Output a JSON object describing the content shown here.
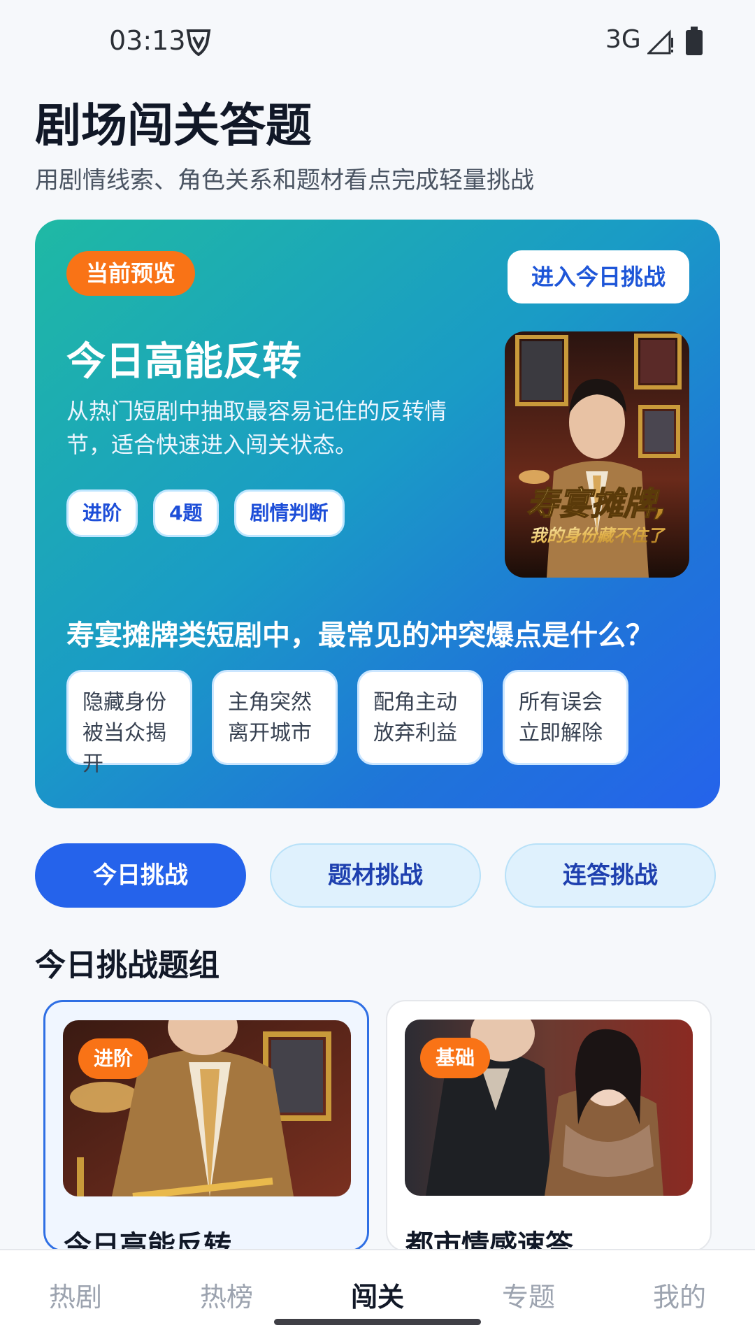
{
  "status_bar": {
    "time": "03:13",
    "network": "3G"
  },
  "header": {
    "title": "剧场闯关答题",
    "subtitle": "用剧情线索、角色关系和题材看点完成轻量挑战"
  },
  "hero": {
    "badge": "当前预览",
    "enter_button": "进入今日挑战",
    "title": "今日高能反转",
    "description": "从热门短剧中抽取最容易记住的反转情节，适合快速进入闯关状态。",
    "tags": [
      "进阶",
      "4题",
      "剧情判断"
    ],
    "poster_caption": "寿宴摊牌，我的身份藏不住了",
    "question": "寿宴摊牌类短剧中，最常见的冲突爆点是什么？",
    "options": [
      "隐藏身份被当众揭开",
      "主角突然离开城市",
      "配角主动放弃利益",
      "所有误会立即解除"
    ]
  },
  "segments": {
    "items": [
      "今日挑战",
      "题材挑战",
      "连答挑战"
    ],
    "active_index": 0
  },
  "section": {
    "title": "今日挑战题组"
  },
  "groups": [
    {
      "badge": "进阶",
      "title": "今日高能反转"
    },
    {
      "badge": "基础",
      "title": "都市情感速答"
    }
  ],
  "bottom_nav": {
    "items": [
      "热剧",
      "热榜",
      "闯关",
      "专题",
      "我的"
    ],
    "active_index": 2
  }
}
